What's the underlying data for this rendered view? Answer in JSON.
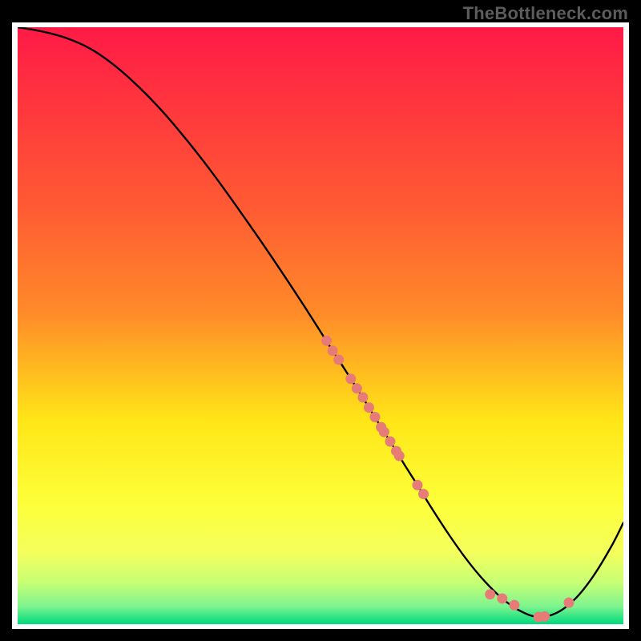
{
  "watermark": "TheBottleneck.com",
  "chart_data": {
    "type": "line",
    "title": "",
    "xlabel": "",
    "ylabel": "",
    "xlim": [
      0,
      100
    ],
    "ylim": [
      0,
      100
    ],
    "grid": false,
    "gradient": {
      "top": "#ff1a46",
      "upper_mid": "#ff8b29",
      "mid": "#ffe617",
      "lower_mid": "#f4ff5c",
      "lower": "#c7ff74",
      "bottom": "#00d97e"
    },
    "series": [
      {
        "name": "curve",
        "type": "line",
        "color": "#000000",
        "x": [
          0,
          4,
          8,
          12,
          16,
          20,
          24,
          28,
          32,
          36,
          40,
          44,
          48,
          52,
          54,
          56,
          58,
          60,
          62,
          64,
          66,
          68,
          71,
          74,
          77,
          80,
          83,
          86,
          89,
          92,
          95,
          98,
          100
        ],
        "y": [
          100,
          99.3,
          98.2,
          96.4,
          93.6,
          90.0,
          85.8,
          81.0,
          75.8,
          70.2,
          64.4,
          58.4,
          52.2,
          45.8,
          42.7,
          39.5,
          36.3,
          33.0,
          29.8,
          26.5,
          23.3,
          20.0,
          15.3,
          11.0,
          7.3,
          4.3,
          2.2,
          1.2,
          1.9,
          4.2,
          8.0,
          13.0,
          17.0
        ]
      },
      {
        "name": "dots",
        "type": "scatter",
        "color": "#e77b77",
        "x": [
          51,
          52,
          53,
          55,
          56,
          57,
          58,
          59,
          60,
          60.5,
          61.5,
          62.5,
          63,
          66,
          67,
          78,
          80,
          82,
          86,
          87,
          91
        ],
        "y": [
          47.5,
          45.8,
          44.3,
          41.1,
          39.5,
          38.0,
          36.3,
          34.7,
          33.0,
          32.2,
          30.6,
          29.0,
          28.2,
          23.3,
          21.8,
          5.0,
          4.3,
          3.2,
          1.2,
          1.3,
          3.6
        ]
      }
    ]
  }
}
